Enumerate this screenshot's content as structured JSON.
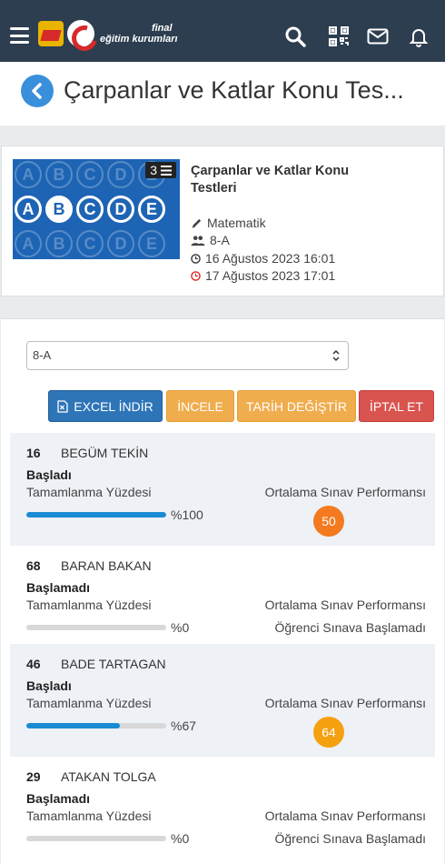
{
  "app": {
    "logo_line1": "final",
    "logo_line2": "eğitim kurumları",
    "logo_mark": "final"
  },
  "header": {
    "title": "Çarpanlar ve Katlar Konu Tes..."
  },
  "assignment": {
    "title": "Çarpanlar ve Katlar Konu Testleri",
    "count": "3",
    "subject": "Matematik",
    "class": "8-A",
    "start_date": "16 Ağustos 2023 16:01",
    "end_date": "17 Ağustos 2023 17:01",
    "thumbnail_letters": [
      "A",
      "B",
      "C",
      "D",
      "E"
    ]
  },
  "filter": {
    "selected_class": "8-A"
  },
  "actions": {
    "excel": "EXCEL İNDİR",
    "review": "İNCELE",
    "change_date": "TARİH DEĞİŞTİR",
    "cancel": "İPTAL ET"
  },
  "labels": {
    "completion": "Tamamlanma Yüzdesi",
    "performance": "Ortalama Sınav Performansı"
  },
  "students": [
    {
      "number": "16",
      "name": "BEGÜM TEKİN",
      "status": "Başladı",
      "progress": 100,
      "progress_text": "%100",
      "score": "50",
      "score_color": "#f47a1f",
      "not_started_text": ""
    },
    {
      "number": "68",
      "name": "BARAN BAKAN",
      "status": "Başlamadı",
      "progress": 0,
      "progress_text": "%0",
      "score": "",
      "score_color": "",
      "not_started_text": "Öğrenci Sınava Başlamadı"
    },
    {
      "number": "46",
      "name": "BADE TARTAGAN",
      "status": "Başladı",
      "progress": 67,
      "progress_text": "%67",
      "score": "64",
      "score_color": "#f5a00f",
      "not_started_text": ""
    },
    {
      "number": "29",
      "name": "ATAKAN TOLGA",
      "status": "Başlamadı",
      "progress": 0,
      "progress_text": "%0",
      "score": "",
      "score_color": "",
      "not_started_text": "Öğrenci Sınava Başlamadı"
    }
  ],
  "colors": {
    "topbar": "#2c3e4f",
    "primary": "#2e75b8",
    "warning": "#f0ad4e",
    "danger": "#d9534f",
    "progress": "#1a8ad4"
  }
}
